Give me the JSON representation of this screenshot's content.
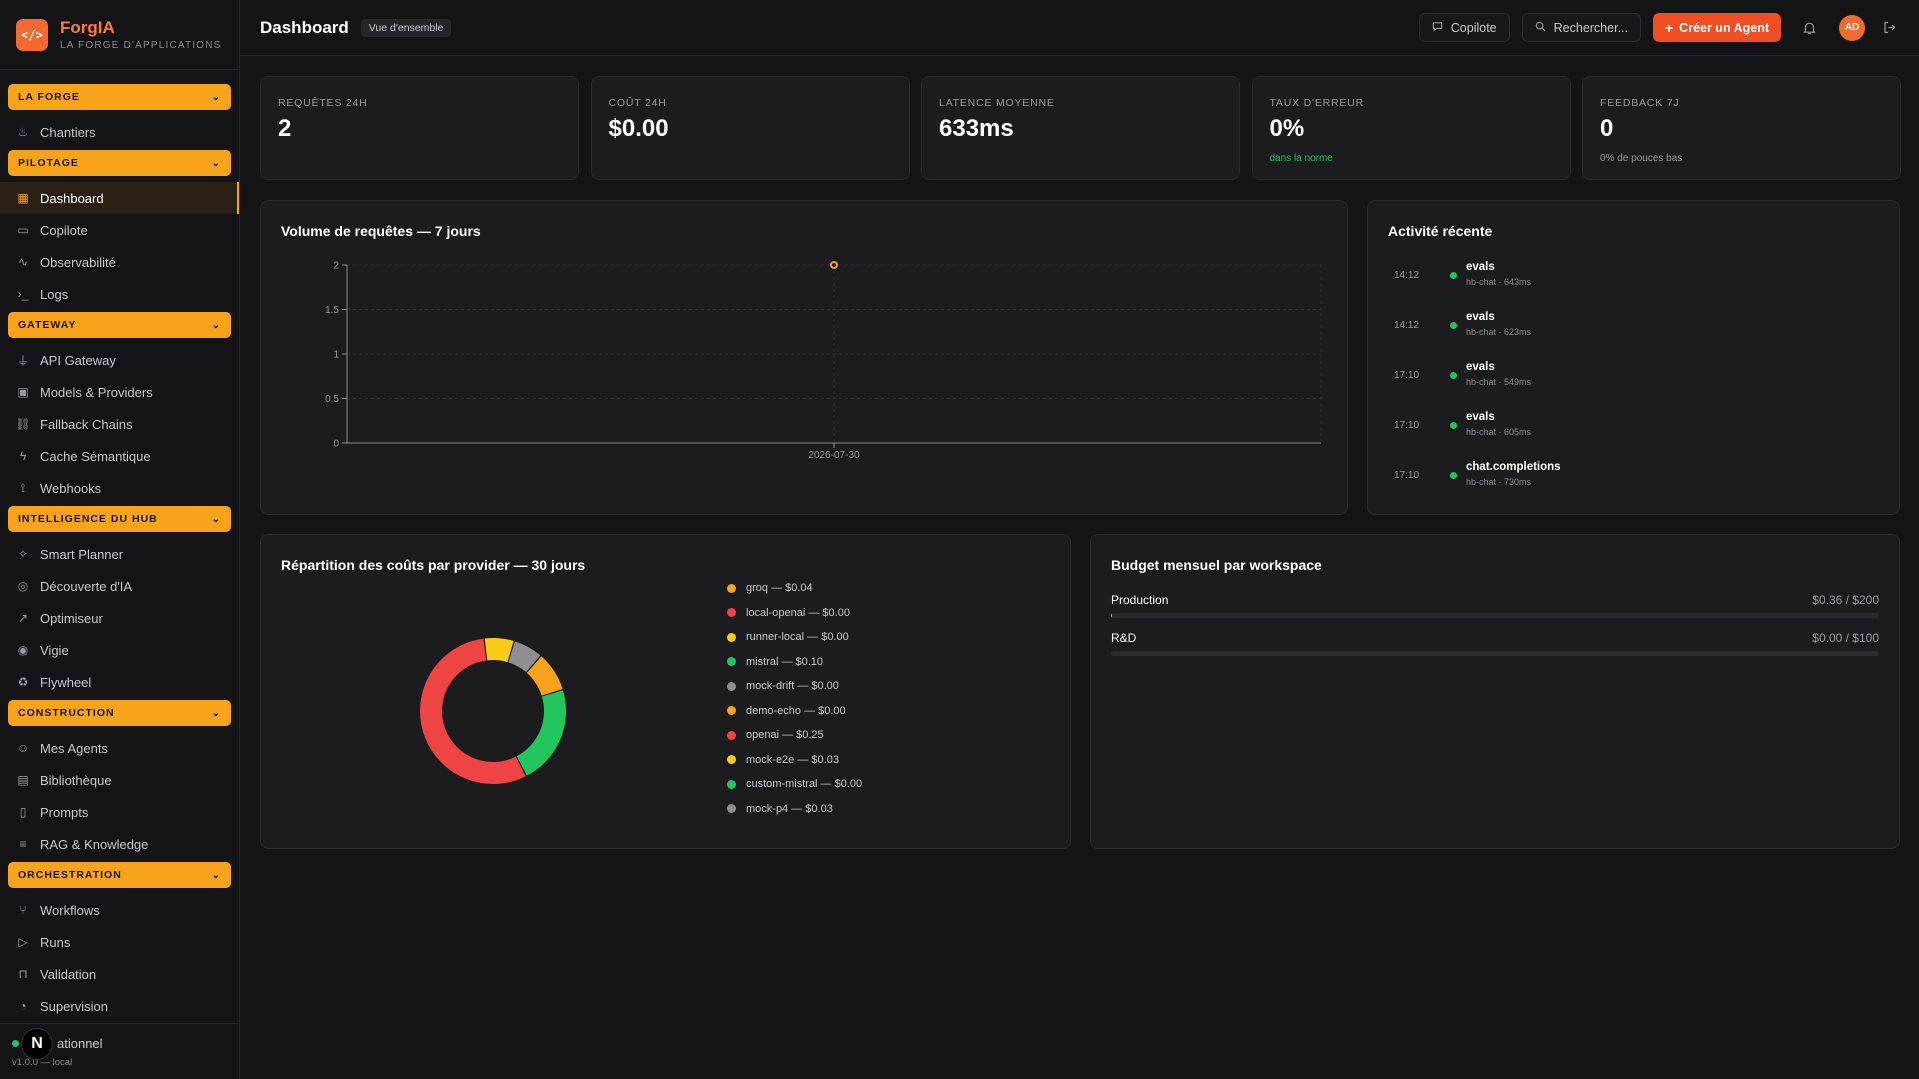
{
  "brand": {
    "name": "ForgIA",
    "tagline": "LA FORGE D'APPLICATIONS",
    "logo_icon": "code-icon"
  },
  "sidebar": {
    "sections": [
      {
        "label": "LA FORGE",
        "items": [
          {
            "label": "Chantiers",
            "icon": "flame-icon"
          }
        ]
      },
      {
        "label": "PILOTAGE",
        "items": [
          {
            "label": "Dashboard",
            "icon": "grid-icon",
            "active": true
          },
          {
            "label": "Copilote",
            "icon": "chat-icon"
          },
          {
            "label": "Observabilité",
            "icon": "activity-icon"
          },
          {
            "label": "Logs",
            "icon": "terminal-icon"
          }
        ]
      },
      {
        "label": "GATEWAY",
        "items": [
          {
            "label": "API Gateway",
            "icon": "plug-icon"
          },
          {
            "label": "Models & Providers",
            "icon": "cpu-icon"
          },
          {
            "label": "Fallback Chains",
            "icon": "chain-icon"
          },
          {
            "label": "Cache Sémantique",
            "icon": "bolt-icon"
          },
          {
            "label": "Webhooks",
            "icon": "webhook-icon"
          }
        ]
      },
      {
        "label": "INTELLIGENCE DU HUB",
        "items": [
          {
            "label": "Smart Planner",
            "icon": "sparkles-icon"
          },
          {
            "label": "Découverte d'IA",
            "icon": "compass-icon"
          },
          {
            "label": "Optimiseur",
            "icon": "trend-icon"
          },
          {
            "label": "Vigie",
            "icon": "radar-icon"
          },
          {
            "label": "Flywheel",
            "icon": "recycle-icon"
          }
        ]
      },
      {
        "label": "CONSTRUCTION",
        "items": [
          {
            "label": "Mes Agents",
            "icon": "bot-icon"
          },
          {
            "label": "Bibliothèque",
            "icon": "library-icon"
          },
          {
            "label": "Prompts",
            "icon": "file-icon"
          },
          {
            "label": "RAG & Knowledge",
            "icon": "database-icon"
          }
        ]
      },
      {
        "label": "ORCHESTRATION",
        "items": [
          {
            "label": "Workflows",
            "icon": "workflow-icon"
          },
          {
            "label": "Runs",
            "icon": "play-icon"
          },
          {
            "label": "Validation",
            "icon": "inbox-icon"
          },
          {
            "label": "Supervision",
            "icon": "gauge-icon"
          }
        ]
      }
    ],
    "footer": {
      "status": "ationnel",
      "version": "v1.0.0 — local",
      "badge": "N"
    }
  },
  "topbar": {
    "title": "Dashboard",
    "badge": "Vue d'ensemble",
    "copilot": "Copilote",
    "search": "Rechercher...",
    "create": "Créer un Agent",
    "avatar": "AD"
  },
  "stats": [
    {
      "label": "REQUÊTES 24H",
      "value": "2",
      "sub": ""
    },
    {
      "label": "COÛT 24H",
      "value": "$0.00",
      "sub": ""
    },
    {
      "label": "LATENCE MOYENNE",
      "value": "633ms",
      "sub": ""
    },
    {
      "label": "TAUX D'ERREUR",
      "value": "0%",
      "sub": "dans la norme"
    },
    {
      "label": "FEEDBACK 7J",
      "value": "0",
      "sub": "0% de pouces bas"
    }
  ],
  "volume": {
    "title": "Volume de requêtes — 7 jours"
  },
  "activity": {
    "title": "Activité récente",
    "rows": [
      {
        "time": "14:12",
        "name": "evals",
        "meta": "hb-chat · 643ms"
      },
      {
        "time": "14:12",
        "name": "evals",
        "meta": "hb-chat · 623ms"
      },
      {
        "time": "17:10",
        "name": "evals",
        "meta": "hb-chat · 549ms"
      },
      {
        "time": "17:10",
        "name": "evals",
        "meta": "hb-chat · 605ms"
      },
      {
        "time": "17:10",
        "name": "chat.completions",
        "meta": "hb-chat · 730ms"
      }
    ]
  },
  "costs": {
    "title": "Répartition des coûts par provider — 30 jours"
  },
  "budget": {
    "title": "Budget mensuel par workspace",
    "rows": [
      {
        "name": "Production",
        "value": "$0.36 / $200",
        "fraction": 0.0018
      },
      {
        "name": "R&D",
        "value": "$0.00 / $100",
        "fraction": 0
      }
    ]
  },
  "colors": {
    "accent": "#f7a41c",
    "primary": "#f04e23",
    "ok": "#22c55e"
  },
  "chart_data": [
    {
      "type": "scatter",
      "title": "Volume de requêtes — 7 jours",
      "x": [
        "2026-07-30"
      ],
      "series": [
        {
          "values": [
            2
          ]
        }
      ],
      "ylim": [
        0,
        2
      ],
      "yticks": [
        "0",
        "0.5",
        "1",
        "1.5",
        "2"
      ],
      "xticks": [
        "2026-07-30"
      ],
      "grid": true,
      "color": "#f7a41c"
    },
    {
      "type": "pie",
      "title": "Répartition des coûts par provider — 30 jours",
      "donut": true,
      "labels": [
        "groq — $0.04",
        "local-openai — $0.00",
        "runner-local — $0.00",
        "mistral — $0.10",
        "mock-drift — $0.00",
        "demo-echo — $0.00",
        "openai — $0.25",
        "mock-e2e — $0.03",
        "custom-mistral — $0.00",
        "mock-p4 — $0.03"
      ],
      "values": [
        0.04,
        0.0,
        0.0,
        0.1,
        0.0,
        0.0,
        0.25,
        0.03,
        0.0,
        0.03
      ],
      "colors": [
        "#f7a41c",
        "#ef4444",
        "#facc15",
        "#22c55e",
        "#8e8e93",
        "#f7a41c",
        "#ef4444",
        "#facc15",
        "#22c55e",
        "#8e8e93"
      ],
      "legend": "right"
    }
  ]
}
